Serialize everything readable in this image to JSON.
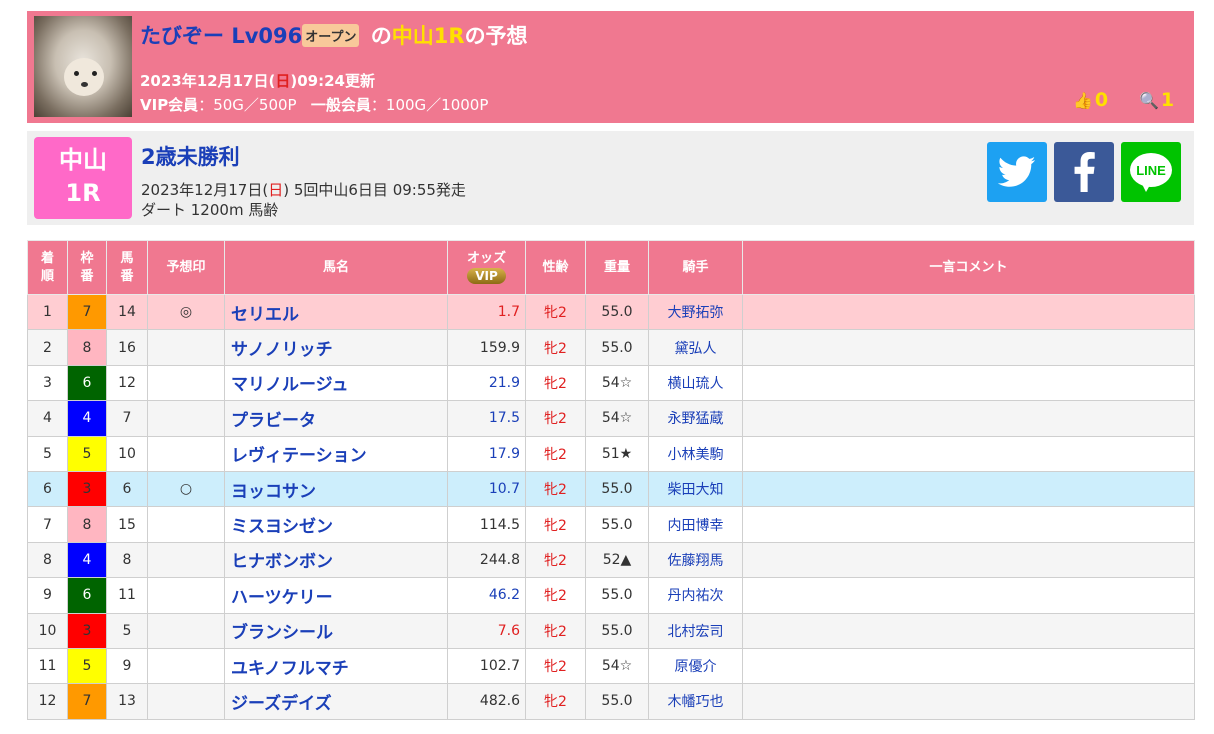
{
  "header": {
    "name": "たびぞー",
    "level": "Lv096",
    "rank_badge": "オープン",
    "title_mid": "の",
    "title_race": "中山1R",
    "title_tail": "の予想",
    "updated_pre": "2023年12月17日(",
    "updated_day": "日",
    "updated_post": ")09:24更新",
    "vip_label": "VIP会員",
    "vip_price": "：50G／500P",
    "general_label": "一般会員",
    "general_price": "：100G／1000P",
    "likes": "0",
    "views": "1"
  },
  "race": {
    "venue": "中山",
    "number": "1R",
    "name": "2歳未勝利",
    "date_pre": "2023年12月17日(",
    "date_day": "日",
    "date_post": ") 5回中山6日目 09:55発走",
    "condition": "ダート 1200m 馬齢"
  },
  "table": {
    "headers": {
      "rank": "着順",
      "waku": "枠番",
      "umaban": "馬番",
      "mark": "予想印",
      "horse": "馬名",
      "odds": "オッズ",
      "vip": "VIP",
      "sexage": "性齢",
      "weight": "重量",
      "jockey": "騎手",
      "comment": "一言コメント"
    },
    "rows": [
      {
        "rank": "1",
        "waku": "7",
        "umaban": "14",
        "mark": "◎",
        "horse": "セリエル",
        "odds": "1.7",
        "sexage": "牝2",
        "weight": "55.0",
        "jockey": "大野拓弥"
      },
      {
        "rank": "2",
        "waku": "8",
        "umaban": "16",
        "mark": "",
        "horse": "サノノリッチ",
        "odds": "159.9",
        "sexage": "牝2",
        "weight": "55.0",
        "jockey": "黛弘人"
      },
      {
        "rank": "3",
        "waku": "6",
        "umaban": "12",
        "mark": "",
        "horse": "マリノルージュ",
        "odds": "21.9",
        "sexage": "牝2",
        "weight": "54☆",
        "jockey": "横山琉人"
      },
      {
        "rank": "4",
        "waku": "4",
        "umaban": "7",
        "mark": "",
        "horse": "プラビータ",
        "odds": "17.5",
        "sexage": "牝2",
        "weight": "54☆",
        "jockey": "永野猛蔵"
      },
      {
        "rank": "5",
        "waku": "5",
        "umaban": "10",
        "mark": "",
        "horse": "レヴィテーション",
        "odds": "17.9",
        "sexage": "牝2",
        "weight": "51★",
        "jockey": "小林美駒"
      },
      {
        "rank": "6",
        "waku": "3",
        "umaban": "6",
        "mark": "○",
        "horse": "ヨッコサン",
        "odds": "10.7",
        "sexage": "牝2",
        "weight": "55.0",
        "jockey": "柴田大知"
      },
      {
        "rank": "7",
        "waku": "8",
        "umaban": "15",
        "mark": "",
        "horse": "ミスヨシゼン",
        "odds": "114.5",
        "sexage": "牝2",
        "weight": "55.0",
        "jockey": "内田博幸"
      },
      {
        "rank": "8",
        "waku": "4",
        "umaban": "8",
        "mark": "",
        "horse": "ヒナボンボン",
        "odds": "244.8",
        "sexage": "牝2",
        "weight": "52▲",
        "jockey": "佐藤翔馬"
      },
      {
        "rank": "9",
        "waku": "6",
        "umaban": "11",
        "mark": "",
        "horse": "ハーツケリー",
        "odds": "46.2",
        "sexage": "牝2",
        "weight": "55.0",
        "jockey": "丹内祐次"
      },
      {
        "rank": "10",
        "waku": "3",
        "umaban": "5",
        "mark": "",
        "horse": "ブランシール",
        "odds": "7.6",
        "sexage": "牝2",
        "weight": "55.0",
        "jockey": "北村宏司"
      },
      {
        "rank": "11",
        "waku": "5",
        "umaban": "9",
        "mark": "",
        "horse": "ユキノフルマチ",
        "odds": "102.7",
        "sexage": "牝2",
        "weight": "54☆",
        "jockey": "原優介"
      },
      {
        "rank": "12",
        "waku": "7",
        "umaban": "13",
        "mark": "",
        "horse": "ジーズデイズ",
        "odds": "482.6",
        "sexage": "牝2",
        "weight": "55.0",
        "jockey": "木幡巧也"
      }
    ]
  },
  "colors": {
    "header_bg": "#f07890",
    "accent_blue": "#1a3fb8",
    "venue_pink": "#ff69c8",
    "waku_1": "#ffffff",
    "waku_2": "#333333",
    "waku_3": "#ff0000",
    "waku_4": "#0000ff",
    "waku_5": "#ffff00",
    "waku_6": "#006400",
    "waku_7": "#ff9900",
    "waku_8": "#ffb6c1"
  }
}
